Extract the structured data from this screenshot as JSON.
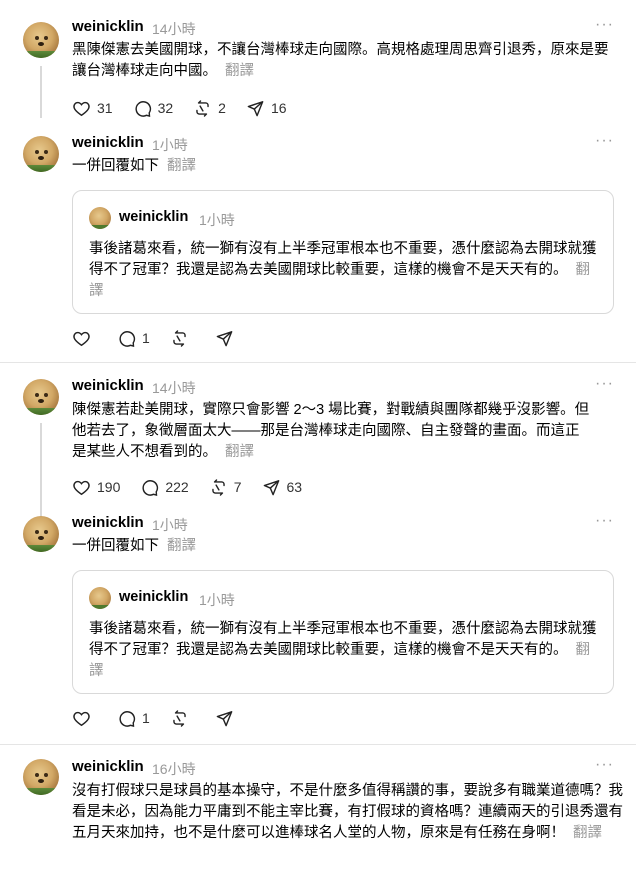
{
  "posts": [
    {
      "username": "weinicklin",
      "time": "14小時",
      "text": "黑陳傑憲去美國開球，不讓台灣棒球走向國際。高規格處理周思齊引退秀，原來是要讓台灣棒球走向中國。",
      "translate": "翻譯",
      "stats": {
        "likes": "31",
        "comments": "32",
        "reposts": "2",
        "shares": "16"
      }
    },
    {
      "username": "weinicklin",
      "time": "1小時",
      "text": "一併回覆如下",
      "translate": "翻譯",
      "quote": {
        "username": "weinicklin",
        "time": "1小時",
        "text": "事後諸葛來看，統一獅有沒有上半季冠軍根本也不重要，憑什麼認為去開球就獲得不了冠軍？我還是認為去美國開球比較重要，這樣的機會不是天天有的。",
        "translate": "翻譯"
      },
      "stats": {
        "likes": "",
        "comments": "1",
        "reposts": "",
        "shares": ""
      }
    },
    {
      "username": "weinicklin",
      "time": "14小時",
      "text": "陳傑憲若赴美開球，實際只會影響 2～3 場比賽，對戰績與團隊都幾乎沒影響。但他若去了，象徵層面太大——那是台灣棒球走向國際、自主發聲的畫面。而這正是某些人不想看到的。",
      "translate": "翻譯",
      "stats": {
        "likes": "190",
        "comments": "222",
        "reposts": "7",
        "shares": "63"
      }
    },
    {
      "username": "weinicklin",
      "time": "1小時",
      "text": "一併回覆如下",
      "translate": "翻譯",
      "quote": {
        "username": "weinicklin",
        "time": "1小時",
        "text": "事後諸葛來看，統一獅有沒有上半季冠軍根本也不重要，憑什麼認為去開球就獲得不了冠軍？我還是認為去美國開球比較重要，這樣的機會不是天天有的。",
        "translate": "翻譯"
      },
      "stats": {
        "likes": "",
        "comments": "1",
        "reposts": "",
        "shares": ""
      }
    },
    {
      "username": "weinicklin",
      "time": "16小時",
      "text": "沒有打假球只是球員的基本操守，不是什麼多值得稱讚的事，要說多有職業道德嗎？我看是未必，因為能力平庸到不能主宰比賽，有打假球的資格嗎？連續兩天的引退秀還有五月天來加持，也不是什麼可以進棒球名人堂的人物，原來是有任務在身啊！",
      "translate": "翻譯"
    }
  ],
  "icons": {
    "more": "more-icon",
    "like": "heart-icon",
    "comment": "comment-icon",
    "repost": "repost-icon",
    "share": "send-icon"
  }
}
